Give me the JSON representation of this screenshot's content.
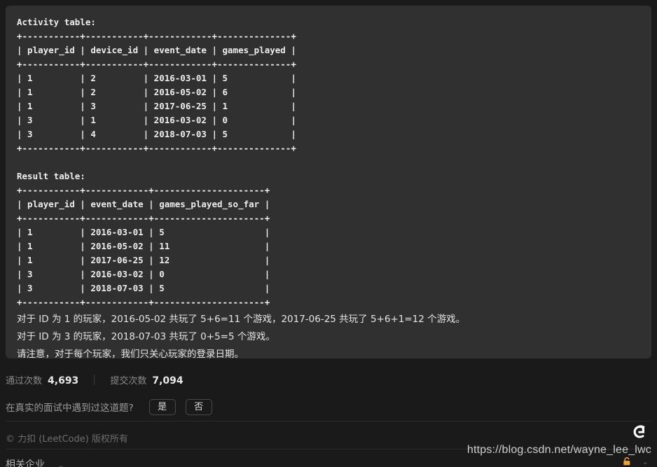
{
  "code_panel": {
    "activity_table_title": "Activity table:",
    "activity_table_text": "Activity table:\n+-----------+-----------+------------+--------------+\n| player_id | device_id | event_date | games_played |\n+-----------+-----------+------------+--------------+\n| 1         | 2         | 2016-03-01 | 5            |\n| 1         | 2         | 2016-05-02 | 6            |\n| 1         | 3         | 2017-06-25 | 1            |\n| 3         | 1         | 2016-03-02 | 0            |\n| 3         | 4         | 2018-07-03 | 5            |\n+-----------+-----------+------------+--------------+",
    "result_table_text": "Result table:\n+-----------+------------+---------------------+\n| player_id | event_date | games_played_so_far |\n+-----------+------------+---------------------+\n| 1         | 2016-03-01 | 5                   |\n| 1         | 2016-05-02 | 11                  |\n| 1         | 2017-06-25 | 12                  |\n| 3         | 2016-03-02 | 0                   |\n| 3         | 2018-07-03 | 5                   |\n+-----------+------------+---------------------+",
    "activity_table": {
      "headers": [
        "player_id",
        "device_id",
        "event_date",
        "games_played"
      ],
      "rows": [
        [
          "1",
          "2",
          "2016-03-01",
          "5"
        ],
        [
          "1",
          "2",
          "2016-05-02",
          "6"
        ],
        [
          "1",
          "3",
          "2017-06-25",
          "1"
        ],
        [
          "3",
          "1",
          "2016-03-02",
          "0"
        ],
        [
          "3",
          "4",
          "2018-07-03",
          "5"
        ]
      ]
    },
    "result_table": {
      "title": "Result table:",
      "headers": [
        "player_id",
        "event_date",
        "games_played_so_far"
      ],
      "rows": [
        [
          "1",
          "2016-03-01",
          "5"
        ],
        [
          "1",
          "2016-05-02",
          "11"
        ],
        [
          "1",
          "2017-06-25",
          "12"
        ],
        [
          "3",
          "2016-03-02",
          "0"
        ],
        [
          "3",
          "2018-07-03",
          "5"
        ]
      ]
    },
    "explanation_lines": [
      "对于 ID 为 1 的玩家，2016-05-02 共玩了 5+6=11 个游戏，2017-06-25 共玩了 5+6+1=12 个游戏。",
      "对于 ID 为 3 的玩家，2018-07-03 共玩了 0+5=5 个游戏。",
      "请注意，对于每个玩家，我们只关心玩家的登录日期。"
    ]
  },
  "stats": {
    "accepted_label": "通过次数",
    "accepted_value": "4,693",
    "submissions_label": "提交次数",
    "submissions_value": "7,094"
  },
  "interview": {
    "question": "在真实的面试中遇到过这道题?",
    "yes_label": "是",
    "no_label": "否"
  },
  "footer": {
    "copyright": "© 力扣 (LeetCode) 版权所有",
    "related_companies": "相关企业",
    "caret": "⌄"
  },
  "watermark": {
    "url": "https://blog.csdn.net/wayne_lee_lwc",
    "logo_name": "csdn-logo",
    "lock_name": "lock-icon"
  },
  "colors": {
    "page_bg": "#1a1a1a",
    "panel_bg": "#303030",
    "code_text": "#ededed",
    "muted_text": "#8a8a8a",
    "lock_orange": "#e8a33d"
  }
}
